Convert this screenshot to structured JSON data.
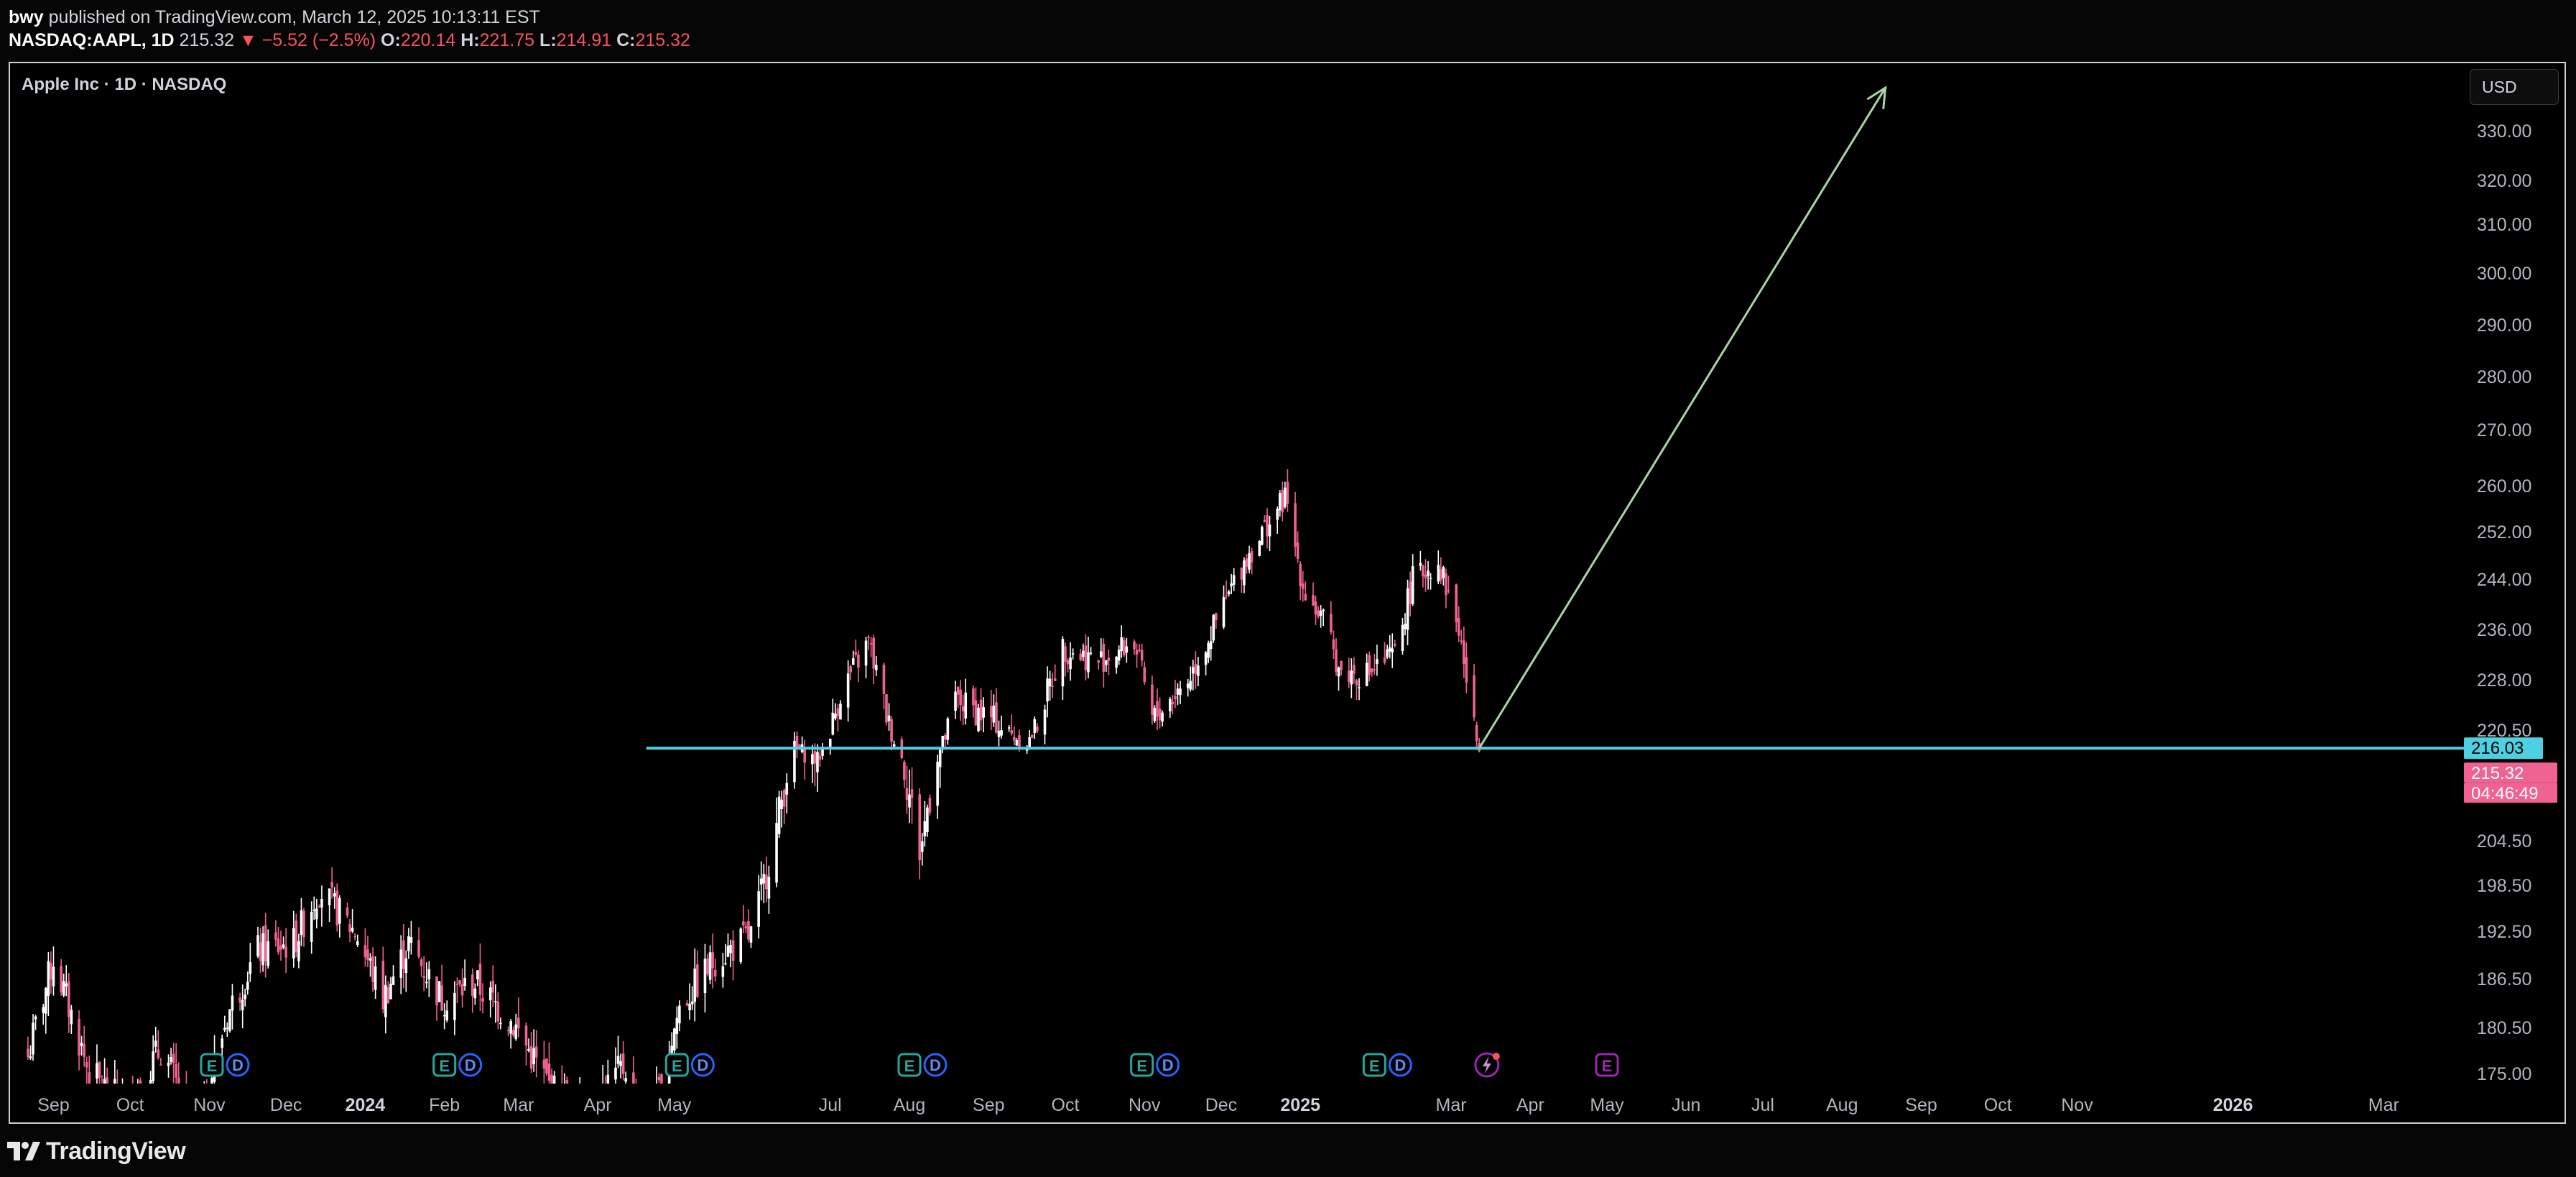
{
  "header": {
    "author": "bwy",
    "published_text": "published on TradingView.com, March 12, 2025 10:13:11 EST",
    "symbol": "NASDAQ:AAPL, 1D",
    "last": "215.32",
    "change": "▼ −5.52 (−2.5%)",
    "open_label": "O:",
    "open": "220.14",
    "high_label": "H:",
    "high": "221.75",
    "low_label": "L:",
    "low": "214.91",
    "close_label": "C:",
    "close": "215.32"
  },
  "chart_title": "Apple Inc · 1D · NASDAQ",
  "currency_button": "USD",
  "footer": {
    "logo_text": "TradingView"
  },
  "colors": {
    "up": "#ffffff",
    "down": "#f06292",
    "support_line": "#4dd0e1",
    "arrow": "#a5d6a7",
    "earnings_badge": "#26a69a",
    "dividend_badge": "#2962ff",
    "split_badge": "#9c27b0"
  },
  "chart_data": {
    "type": "candlestick",
    "y_axis": {
      "tick_labels": [
        "330.00",
        "320.00",
        "310.00",
        "300.00",
        "290.00",
        "280.00",
        "270.00",
        "260.00",
        "252.00",
        "244.00",
        "236.00",
        "228.00",
        "220.50",
        "204.50",
        "198.50",
        "192.50",
        "186.50",
        "180.50",
        "175.00"
      ],
      "range": [
        175,
        333
      ]
    },
    "x_axis": {
      "tick_labels": [
        "Sep",
        "Oct",
        "Nov",
        "Dec",
        "2024",
        "Feb",
        "Mar",
        "Apr",
        "May",
        "Jul",
        "Aug",
        "Sep",
        "Oct",
        "Nov",
        "Dec",
        "2025",
        "Mar",
        "Apr",
        "May",
        "Jun",
        "Jul",
        "Aug",
        "Sep",
        "Oct",
        "Nov",
        "2026",
        "Mar"
      ]
    },
    "price_labels": [
      {
        "value": "216.03",
        "color": "#4dd0e1"
      },
      {
        "value": "215.32",
        "color": "#f06292"
      },
      {
        "value": "04:46:49",
        "color": "#f06292"
      }
    ],
    "trend_points": [
      [
        "2023-08-22",
        177
      ],
      [
        "2023-09-01",
        189
      ],
      [
        "2023-09-15",
        175
      ],
      [
        "2023-09-29",
        171
      ],
      [
        "2023-10-13",
        178
      ],
      [
        "2023-10-27",
        168
      ],
      [
        "2023-11-08",
        182
      ],
      [
        "2023-11-20",
        190
      ],
      [
        "2023-12-04",
        191
      ],
      [
        "2023-12-14",
        198
      ],
      [
        "2023-12-29",
        192
      ],
      [
        "2024-01-08",
        184
      ],
      [
        "2024-01-18",
        191
      ],
      [
        "2024-01-31",
        184
      ],
      [
        "2024-02-13",
        186
      ],
      [
        "2024-02-28",
        181
      ],
      [
        "2024-03-14",
        173
      ],
      [
        "2024-03-28",
        171
      ],
      [
        "2024-04-12",
        176
      ],
      [
        "2024-04-19",
        165
      ],
      [
        "2024-05-03",
        183
      ],
      [
        "2024-05-17",
        189
      ],
      [
        "2024-05-31",
        192
      ],
      [
        "2024-06-11",
        207
      ],
      [
        "2024-06-17",
        216
      ],
      [
        "2024-06-26",
        213
      ],
      [
        "2024-07-05",
        226
      ],
      [
        "2024-07-16",
        234
      ],
      [
        "2024-07-26",
        218
      ],
      [
        "2024-08-05",
        203
      ],
      [
        "2024-08-19",
        225
      ],
      [
        "2024-09-03",
        222
      ],
      [
        "2024-09-16",
        217
      ],
      [
        "2024-09-30",
        233
      ],
      [
        "2024-10-14",
        231
      ],
      [
        "2024-10-28",
        234
      ],
      [
        "2024-11-04",
        222
      ],
      [
        "2024-11-18",
        228
      ],
      [
        "2024-11-29",
        237
      ],
      [
        "2024-12-10",
        247
      ],
      [
        "2024-12-26",
        258
      ],
      [
        "2025-01-02",
        243
      ],
      [
        "2025-01-10",
        237
      ],
      [
        "2025-01-17",
        229
      ],
      [
        "2025-01-27",
        229
      ],
      [
        "2025-02-07",
        232
      ],
      [
        "2025-02-14",
        244
      ],
      [
        "2025-02-24",
        247
      ],
      [
        "2025-03-04",
        236
      ],
      [
        "2025-03-12",
        215.32
      ]
    ],
    "support_level": 216.03,
    "support_start": "2024-04-20",
    "projection_arrow": {
      "from": [
        "2025-03-12",
        216
      ],
      "to": [
        "2025-08-18",
        333
      ]
    },
    "events": [
      {
        "date": "2023-11-02",
        "badges": [
          "E",
          "D"
        ]
      },
      {
        "date": "2024-02-01",
        "badges": [
          "E",
          "D"
        ]
      },
      {
        "date": "2024-05-02",
        "badges": [
          "E",
          "D"
        ]
      },
      {
        "date": "2024-08-01",
        "badges": [
          "E",
          "D"
        ]
      },
      {
        "date": "2024-10-31",
        "badges": [
          "E",
          "D"
        ]
      },
      {
        "date": "2025-01-30",
        "badges": [
          "E",
          "D"
        ]
      },
      {
        "date": "2025-03-15",
        "badges": [
          "split"
        ]
      },
      {
        "date": "2025-05-01",
        "badges": [
          "E"
        ]
      }
    ],
    "grid": false
  }
}
